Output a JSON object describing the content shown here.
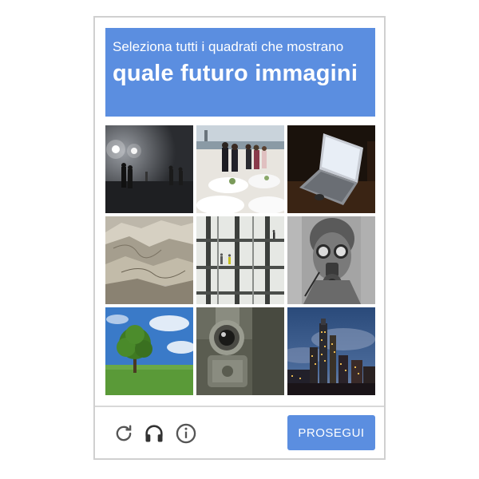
{
  "header": {
    "instruction": "Seleziona tutti i quadrati che mostrano",
    "target": "quale futuro immagini"
  },
  "tiles": [
    {
      "name": "tile-foggy-night-street"
    },
    {
      "name": "tile-banquet-waterfront"
    },
    {
      "name": "tile-laptop-dark"
    },
    {
      "name": "tile-badlands-hills"
    },
    {
      "name": "tile-glass-grid-building"
    },
    {
      "name": "tile-gas-mask-mural"
    },
    {
      "name": "tile-tree-in-field"
    },
    {
      "name": "tile-old-camera-lens"
    },
    {
      "name": "tile-city-skyline-dusk"
    }
  ],
  "footer": {
    "reload_icon": "reload-icon",
    "audio_icon": "headphones-icon",
    "info_icon": "info-icon",
    "verify_label": "PROSEGUI"
  },
  "colors": {
    "accent": "#5b8ee0",
    "border": "#d0d0d0",
    "icon": "#555555"
  }
}
